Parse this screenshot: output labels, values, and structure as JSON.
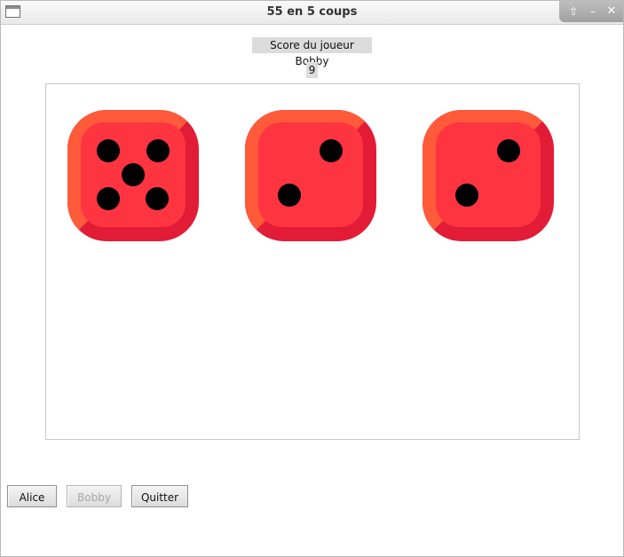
{
  "window": {
    "title": "55 en 5 coups",
    "controls": [
      "maximize-icon",
      "minimize-icon",
      "close-icon"
    ]
  },
  "score": {
    "label": "Score du joueur Bobby",
    "value": "9"
  },
  "dice": [
    {
      "value": 5
    },
    {
      "value": 2
    },
    {
      "value": 2
    }
  ],
  "colors": {
    "die_face": "#FF3441",
    "die_light_edge": "#FF5A3A",
    "die_dark_edge": "#E21C36",
    "pip": "#000000"
  },
  "buttons": [
    {
      "label": "Alice",
      "enabled": true
    },
    {
      "label": "Bobby",
      "enabled": false
    },
    {
      "label": "Quitter",
      "enabled": true
    }
  ]
}
